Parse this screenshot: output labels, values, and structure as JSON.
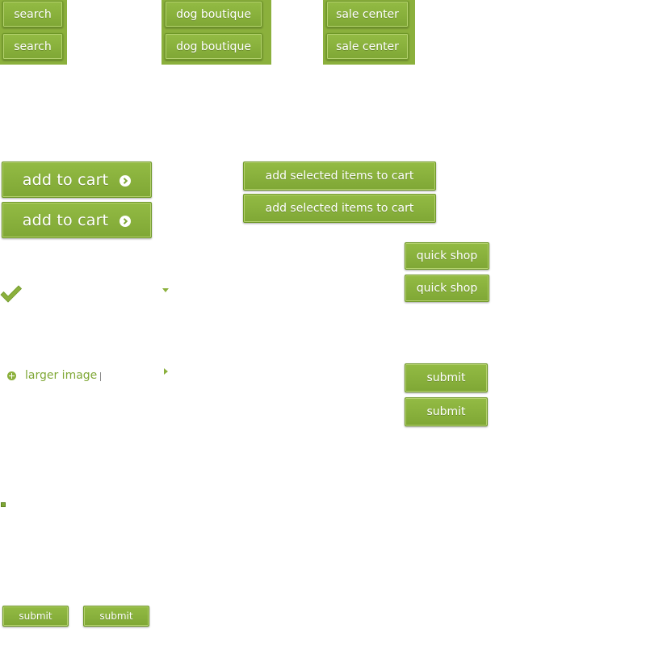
{
  "row1": {
    "search": [
      "search",
      "search"
    ],
    "dog_boutique": [
      "dog boutique",
      "dog boutique"
    ],
    "sale_center": [
      "sale center",
      "sale center"
    ]
  },
  "add_to_cart": [
    "add to cart",
    "add to cart"
  ],
  "add_selected": [
    "add selected items to cart",
    "add selected items to cart"
  ],
  "quick_shop": [
    "quick shop",
    "quick shop"
  ],
  "submit_large": [
    "submit",
    "submit"
  ],
  "larger_image": {
    "label": "larger image"
  },
  "submit_small": [
    "submit",
    "submit"
  ],
  "icons": {
    "check": "checkmark-icon",
    "dropdown": "triangle-down-icon",
    "expand": "triangle-right-icon",
    "plus": "plus-circle-icon",
    "arrow": "arrow-right-circle-icon",
    "close": "close-icon"
  },
  "colors": {
    "accent": "#8bb03c",
    "accent_dark": "#6f9828",
    "highlight": "#b4d16e",
    "text_on_accent": "#ffffff"
  }
}
